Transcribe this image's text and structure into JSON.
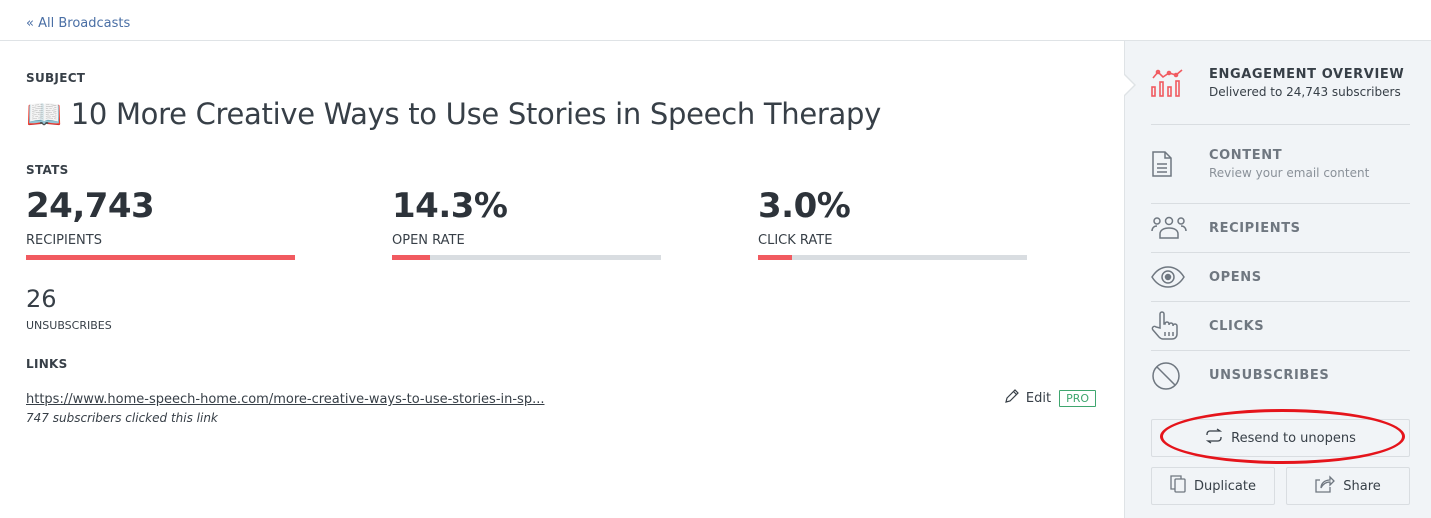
{
  "topbar": {
    "back_link": "« All Broadcasts"
  },
  "subject": {
    "label": "SUBJECT",
    "emoji": "📖",
    "title": "10 More Creative Ways to Use Stories in Speech Therapy"
  },
  "stats": {
    "label": "STATS",
    "items": [
      {
        "value": "24,743",
        "name": "RECIPIENTS",
        "progress_percent": 100
      },
      {
        "value": "14.3%",
        "name": "OPEN RATE",
        "progress_percent": 14.3
      },
      {
        "value": "3.0%",
        "name": "CLICK RATE",
        "progress_percent": 12.6
      }
    ],
    "unsubscribes": {
      "value": "26",
      "name": "UNSUBSCRIBES"
    }
  },
  "links": {
    "label": "LINKS",
    "items": [
      {
        "url": "https://www.home-speech-home.com/more-creative-ways-to-use-stories-in-sp...",
        "clicks_text": "747 subscribers clicked this link",
        "edit_label": "Edit",
        "badge": "PRO"
      }
    ]
  },
  "sidebar": {
    "nav": [
      {
        "title": "ENGAGEMENT OVERVIEW",
        "subtitle": "Delivered to 24,743 subscribers",
        "icon": "chart-icon",
        "active": true
      },
      {
        "title": "CONTENT",
        "subtitle": "Review your email content",
        "icon": "document-icon"
      },
      {
        "title": "RECIPIENTS",
        "icon": "people-icon"
      },
      {
        "title": "OPENS",
        "icon": "eye-icon"
      },
      {
        "title": "CLICKS",
        "icon": "pointer-hand-icon"
      },
      {
        "title": "UNSUBSCRIBES",
        "icon": "ban-icon"
      }
    ],
    "buttons": {
      "resend": "Resend to unopens",
      "duplicate": "Duplicate",
      "share": "Share"
    }
  },
  "colors": {
    "accent": "#f15a60",
    "link": "#4a6fa5",
    "pro_badge": "#3fa66f",
    "annotation": "#e5141b"
  }
}
